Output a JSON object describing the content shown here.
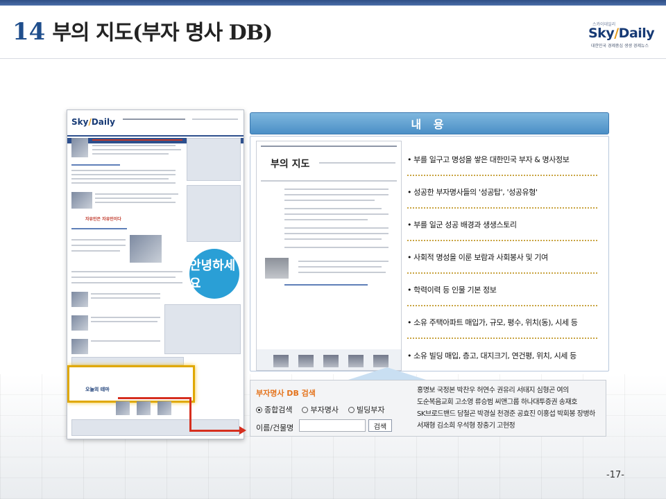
{
  "header": {
    "number": "14",
    "title": "부의 지도(부자 명사 DB)"
  },
  "logo": {
    "small": "스카이데일리",
    "main_a": "Sky",
    "main_b": "Daily",
    "sub": "대한민국 경제중심 생생 경제뉴스"
  },
  "site_shot": {
    "logo_a": "Sky",
    "logo_b": "Daily",
    "greeting": "안녕하세요",
    "promo": "자유인은 자유인이다",
    "highlight_label": "오늘의 테마"
  },
  "content": {
    "header": "내 용",
    "shot_title": "부의 지도",
    "bullets": [
      "• 부를 일구고 명성을 쌓은 대한민국 부자 & 명사정보",
      "• 성공한 부자명사들의 '성공탑', '성공유형'",
      "• 부를 일군 성공 배경과 생생스토리",
      "• 사회적 명성을 이룬 보람과 사회봉사 및 기여",
      "• 학력이력 등 인물 기본 정보",
      "• 소유 주택아파트 매입가, 규모, 평수, 위치(동), 시세 등",
      "• 소유 빌딩 매입, 층고, 대지크기, 연건평, 위치, 시세 등"
    ]
  },
  "search": {
    "title": "부자명사 DB 검색",
    "options": [
      "종합검색",
      "부자명사",
      "빌딩부자"
    ],
    "selected": "종합검색",
    "name_label": "이름/건물명",
    "name_value": "",
    "button": "검색",
    "names": "홍명보 국정본 박찬우 허연수 권유리 서태지 심형곤 여의 도순복음교회 고소영 류승범 씨앤그룹 하나대투증권 송재호 SK브로드밴드 담철곤 박경실 천경준 공효진 이홍섭 박회봉 장병하 서재형 김소희 우석형 장충기 고현정"
  },
  "page": {
    "number": "-17-"
  },
  "colors": {
    "accent_blue": "#1f4e8c",
    "highlight": "#e0a800",
    "connector": "#d62f1f",
    "search_title": "#e4731c"
  }
}
